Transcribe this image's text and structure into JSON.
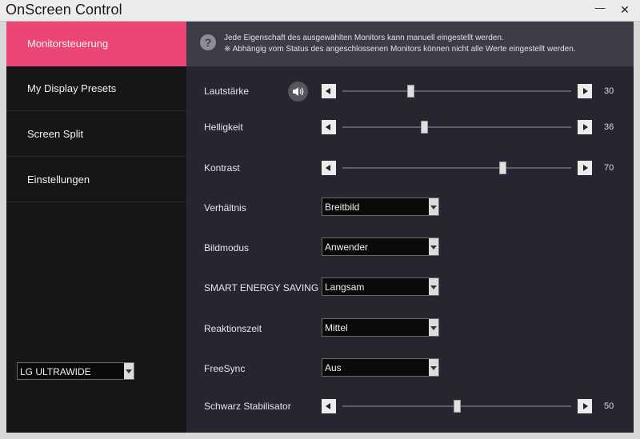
{
  "window": {
    "title": "OnScreen Control",
    "minimize": "—",
    "close": "✕"
  },
  "sidebar": {
    "items": [
      {
        "label": "Monitorsteuerung"
      },
      {
        "label": "My Display Presets"
      },
      {
        "label": "Screen Split"
      },
      {
        "label": "Einstellungen"
      }
    ],
    "monitor": "LG ULTRAWIDE"
  },
  "info": {
    "line1": "Jede Eigenschaft des ausgewählten Monitors kann manuell eingestellt werden.",
    "line2": "※ Abhängig vom Status des angeschlossenen Monitors können nicht alle Werte eingestellt werden.",
    "icon": "?"
  },
  "controls": {
    "volume": {
      "label": "Lautstärke",
      "value": "30",
      "fraction": 0.3
    },
    "brightness": {
      "label": "Helligkeit",
      "value": "36",
      "fraction": 0.36
    },
    "contrast": {
      "label": "Kontrast",
      "value": "70",
      "fraction": 0.7
    },
    "ratio": {
      "label": "Verhältnis",
      "value": "Breitbild"
    },
    "picture_mode": {
      "label": "Bildmodus",
      "value": "Anwender"
    },
    "smart_energy": {
      "label": "SMART ENERGY SAVING",
      "value": "Langsam"
    },
    "response_time": {
      "label": "Reaktionszeit",
      "value": "Mittel"
    },
    "freesync": {
      "label": "FreeSync",
      "value": "Aus"
    },
    "black_stabilizer": {
      "label": "Schwarz Stabilisator",
      "value": "50",
      "fraction": 0.5
    }
  },
  "colors": {
    "accent": "#ec4677",
    "sidebar": "#161616",
    "panel": "#262630",
    "info_bar": "#3d3d47"
  }
}
